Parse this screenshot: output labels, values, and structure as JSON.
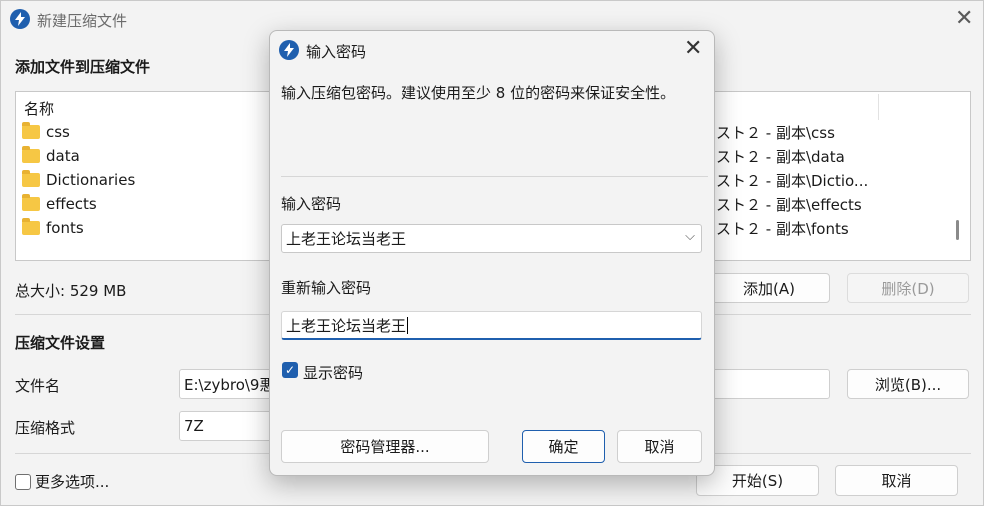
{
  "main": {
    "title": "新建压缩文件",
    "add_section_title": "添加文件到压缩文件",
    "list_header": "名称",
    "items": [
      {
        "name": "css",
        "path": "スト２ - 副本\\css"
      },
      {
        "name": "data",
        "path": "スト２ - 副本\\data"
      },
      {
        "name": "Dictionaries",
        "path": "スト２ - 副本\\Dictio..."
      },
      {
        "name": "effects",
        "path": "スト２ - 副本\\effects"
      },
      {
        "name": "fonts",
        "path": "スト２ - 副本\\fonts"
      }
    ],
    "total_size": "总大小: 529 MB",
    "add_button": "添加(A)",
    "delete_button": "删除(D)",
    "settings_title": "压缩文件设置",
    "filename_label": "文件名",
    "filename_value": "E:\\zybro\\9悪",
    "browse_button": "浏览(B)...",
    "format_label": "压缩格式",
    "format_value": "7Z",
    "more_options_label": "更多选项...",
    "start_button": "开始(S)",
    "cancel_button": "取消"
  },
  "dialog": {
    "title": "输入密码",
    "description": "输入压缩包密码。建议使用至少 8 位的密码来保证安全性。",
    "password_label": "输入密码",
    "password_value": "上老王论坛当老王",
    "confirm_label": "重新输入密码",
    "confirm_value": "上老王论坛当老王",
    "show_password_label": "显示密码",
    "show_password_checked": true,
    "manager_button": "密码管理器...",
    "ok_button": "确定",
    "cancel_button": "取消"
  },
  "colors": {
    "accent": "#1f5fae"
  }
}
